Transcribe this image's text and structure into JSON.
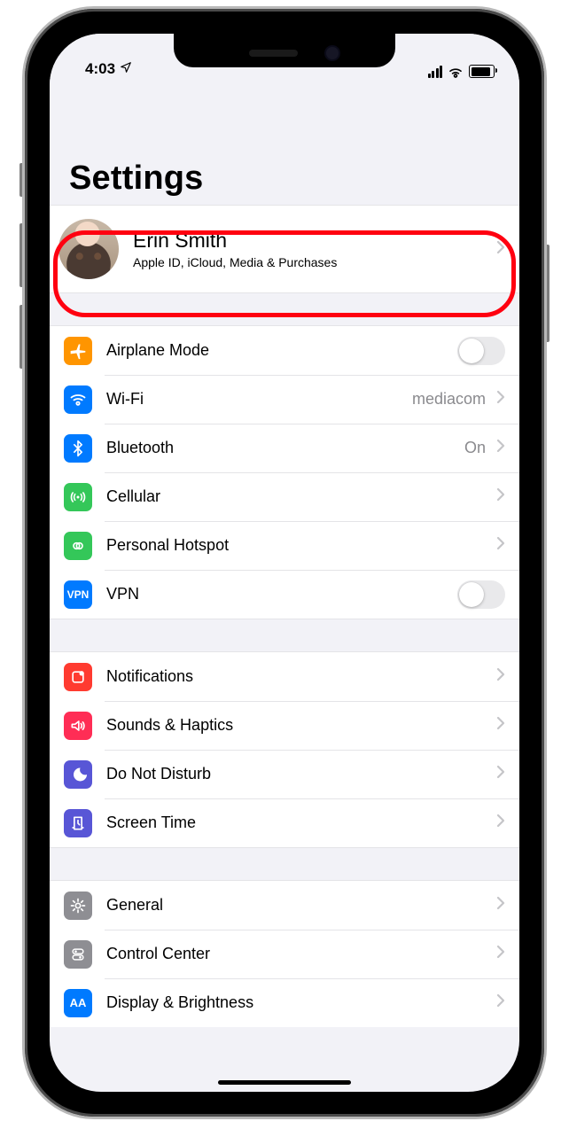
{
  "status": {
    "time": "4:03"
  },
  "header": {
    "title": "Settings"
  },
  "profile": {
    "name": "Erin Smith",
    "subtitle": "Apple ID, iCloud, Media & Purchases"
  },
  "groups": [
    {
      "rows": [
        {
          "label": "Airplane Mode",
          "kind": "switch"
        },
        {
          "label": "Wi-Fi",
          "value": "mediacom",
          "kind": "link"
        },
        {
          "label": "Bluetooth",
          "value": "On",
          "kind": "link"
        },
        {
          "label": "Cellular",
          "kind": "link"
        },
        {
          "label": "Personal Hotspot",
          "kind": "link"
        },
        {
          "label": "VPN",
          "kind": "switch"
        }
      ]
    },
    {
      "rows": [
        {
          "label": "Notifications",
          "kind": "link"
        },
        {
          "label": "Sounds & Haptics",
          "kind": "link"
        },
        {
          "label": "Do Not Disturb",
          "kind": "link"
        },
        {
          "label": "Screen Time",
          "kind": "link"
        }
      ]
    },
    {
      "rows": [
        {
          "label": "General",
          "kind": "link"
        },
        {
          "label": "Control Center",
          "kind": "link"
        },
        {
          "label": "Display & Brightness",
          "kind": "link"
        }
      ]
    }
  ],
  "vpn_badge": "VPN",
  "display_badge": "AA"
}
